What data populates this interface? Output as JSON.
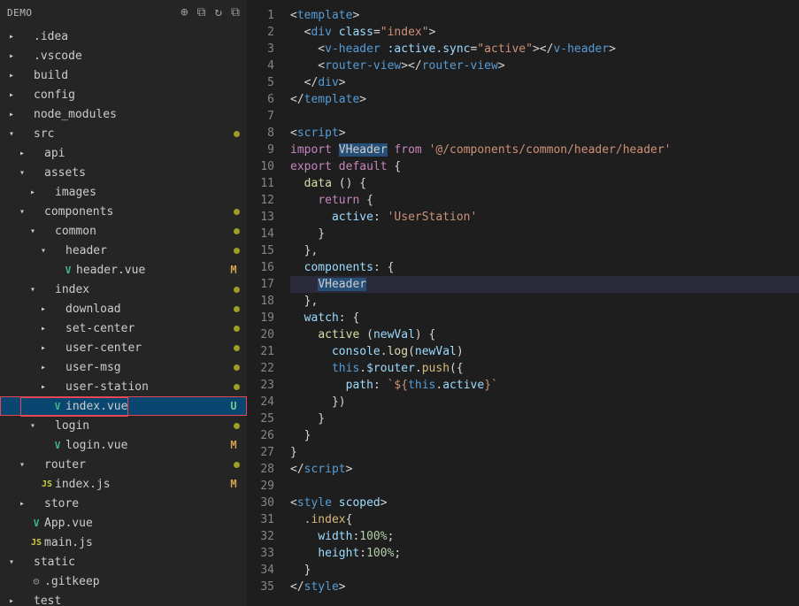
{
  "sidebar": {
    "title": "DEMO",
    "actions": [
      "new-file",
      "new-folder",
      "refresh",
      "collapse"
    ],
    "tree": [
      {
        "indent": 0,
        "chev": "▸",
        "icon": "",
        "label": ".idea"
      },
      {
        "indent": 0,
        "chev": "▸",
        "icon": "",
        "label": ".vscode"
      },
      {
        "indent": 0,
        "chev": "▸",
        "icon": "",
        "label": "build"
      },
      {
        "indent": 0,
        "chev": "▸",
        "icon": "",
        "label": "config"
      },
      {
        "indent": 0,
        "chev": "▸",
        "icon": "",
        "label": "node_modules"
      },
      {
        "indent": 0,
        "chev": "▾",
        "icon": "",
        "label": "src",
        "dot": "olive"
      },
      {
        "indent": 1,
        "chev": "▸",
        "icon": "",
        "label": "api"
      },
      {
        "indent": 1,
        "chev": "▾",
        "icon": "",
        "label": "assets"
      },
      {
        "indent": 2,
        "chev": "▸",
        "icon": "",
        "label": "images"
      },
      {
        "indent": 1,
        "chev": "▾",
        "icon": "",
        "label": "components",
        "dot": "olive"
      },
      {
        "indent": 2,
        "chev": "▾",
        "icon": "",
        "label": "common",
        "dot": "olive"
      },
      {
        "indent": 3,
        "chev": "▾",
        "icon": "",
        "label": "header",
        "dot": "olive"
      },
      {
        "indent": 4,
        "chev": "",
        "icon": "vue",
        "label": "header.vue",
        "letter": "M"
      },
      {
        "indent": 2,
        "chev": "▾",
        "icon": "",
        "label": "index",
        "dot": "olive"
      },
      {
        "indent": 3,
        "chev": "▸",
        "icon": "",
        "label": "download",
        "dot": "olive"
      },
      {
        "indent": 3,
        "chev": "▸",
        "icon": "",
        "label": "set-center",
        "dot": "olive"
      },
      {
        "indent": 3,
        "chev": "▸",
        "icon": "",
        "label": "user-center",
        "dot": "olive"
      },
      {
        "indent": 3,
        "chev": "▸",
        "icon": "",
        "label": "user-msg",
        "dot": "olive"
      },
      {
        "indent": 3,
        "chev": "▸",
        "icon": "",
        "label": "user-station",
        "dot": "olive"
      },
      {
        "indent": 3,
        "chev": "",
        "icon": "vue",
        "label": "index.vue",
        "letter": "U",
        "selected": true
      },
      {
        "indent": 2,
        "chev": "▾",
        "icon": "",
        "label": "login",
        "dot": "olive"
      },
      {
        "indent": 3,
        "chev": "",
        "icon": "vue",
        "label": "login.vue",
        "letter": "M"
      },
      {
        "indent": 1,
        "chev": "▾",
        "icon": "",
        "label": "router",
        "dot": "olive"
      },
      {
        "indent": 2,
        "chev": "",
        "icon": "js",
        "label": "index.js",
        "letter": "M"
      },
      {
        "indent": 1,
        "chev": "▸",
        "icon": "",
        "label": "store"
      },
      {
        "indent": 1,
        "chev": "",
        "icon": "vue",
        "label": "App.vue"
      },
      {
        "indent": 1,
        "chev": "",
        "icon": "js",
        "label": "main.js"
      },
      {
        "indent": 0,
        "chev": "▾",
        "icon": "",
        "label": "static"
      },
      {
        "indent": 1,
        "chev": "",
        "icon": "gear",
        "label": ".gitkeep"
      },
      {
        "indent": 0,
        "chev": "▸",
        "icon": "",
        "label": "test"
      }
    ]
  },
  "editor": {
    "lines": [
      {
        "n": 1,
        "parts": [
          [
            "plain",
            "<"
          ],
          [
            "tag",
            "template"
          ],
          [
            "plain",
            ">"
          ]
        ]
      },
      {
        "n": 2,
        "parts": [
          [
            "plain",
            "  <"
          ],
          [
            "tag",
            "div"
          ],
          [
            "plain",
            " "
          ],
          [
            "attr",
            "class"
          ],
          [
            "plain",
            "="
          ],
          [
            "str",
            "\"index\""
          ],
          [
            "plain",
            ">"
          ]
        ]
      },
      {
        "n": 3,
        "parts": [
          [
            "plain",
            "    <"
          ],
          [
            "tag",
            "v-header"
          ],
          [
            "plain",
            " "
          ],
          [
            "attr",
            ":active.sync"
          ],
          [
            "plain",
            "="
          ],
          [
            "str",
            "\"active\""
          ],
          [
            "plain",
            "></"
          ],
          [
            "tag",
            "v-header"
          ],
          [
            "plain",
            ">"
          ]
        ]
      },
      {
        "n": 4,
        "parts": [
          [
            "plain",
            "    <"
          ],
          [
            "tag",
            "router-view"
          ],
          [
            "plain",
            "></"
          ],
          [
            "tag",
            "router-view"
          ],
          [
            "plain",
            ">"
          ]
        ]
      },
      {
        "n": 5,
        "parts": [
          [
            "plain",
            "  </"
          ],
          [
            "tag",
            "div"
          ],
          [
            "plain",
            ">"
          ]
        ]
      },
      {
        "n": 6,
        "parts": [
          [
            "plain",
            "</"
          ],
          [
            "tag",
            "template"
          ],
          [
            "plain",
            ">"
          ]
        ]
      },
      {
        "n": 7,
        "parts": []
      },
      {
        "n": 8,
        "parts": [
          [
            "plain",
            "<"
          ],
          [
            "tag",
            "script"
          ],
          [
            "plain",
            ">"
          ]
        ]
      },
      {
        "n": 9,
        "parts": [
          [
            "kw",
            "import"
          ],
          [
            "plain",
            " "
          ],
          [
            "sel",
            "VHeader"
          ],
          [
            "plain",
            " "
          ],
          [
            "kw",
            "from"
          ],
          [
            "plain",
            " "
          ],
          [
            "str",
            "'@/components/common/header/header'"
          ]
        ]
      },
      {
        "n": 10,
        "parts": [
          [
            "kw",
            "export"
          ],
          [
            "plain",
            " "
          ],
          [
            "kw",
            "default"
          ],
          [
            "plain",
            " {"
          ]
        ]
      },
      {
        "n": 11,
        "parts": [
          [
            "plain",
            "  "
          ],
          [
            "fn",
            "data"
          ],
          [
            "plain",
            " () {"
          ]
        ]
      },
      {
        "n": 12,
        "parts": [
          [
            "plain",
            "    "
          ],
          [
            "kw",
            "return"
          ],
          [
            "plain",
            " {"
          ]
        ]
      },
      {
        "n": 13,
        "parts": [
          [
            "plain",
            "      "
          ],
          [
            "prop",
            "active"
          ],
          [
            "plain",
            ": "
          ],
          [
            "str",
            "'UserStation'"
          ]
        ]
      },
      {
        "n": 14,
        "parts": [
          [
            "plain",
            "    }"
          ]
        ]
      },
      {
        "n": 15,
        "parts": [
          [
            "plain",
            "  },"
          ]
        ]
      },
      {
        "n": 16,
        "parts": [
          [
            "plain",
            "  "
          ],
          [
            "prop",
            "components"
          ],
          [
            "plain",
            ": {"
          ]
        ]
      },
      {
        "n": 17,
        "current": true,
        "parts": [
          [
            "plain",
            "    "
          ],
          [
            "sel",
            "VHeader"
          ]
        ]
      },
      {
        "n": 18,
        "parts": [
          [
            "plain",
            "  },"
          ]
        ]
      },
      {
        "n": 19,
        "parts": [
          [
            "plain",
            "  "
          ],
          [
            "prop",
            "watch"
          ],
          [
            "plain",
            ": {"
          ]
        ]
      },
      {
        "n": 20,
        "parts": [
          [
            "plain",
            "    "
          ],
          [
            "fn",
            "active"
          ],
          [
            "plain",
            " ("
          ],
          [
            "prop",
            "newVal"
          ],
          [
            "plain",
            ") {"
          ]
        ]
      },
      {
        "n": 21,
        "parts": [
          [
            "plain",
            "      "
          ],
          [
            "prop",
            "console"
          ],
          [
            "plain",
            "."
          ],
          [
            "fn",
            "log"
          ],
          [
            "plain",
            "("
          ],
          [
            "prop",
            "newVal"
          ],
          [
            "plain",
            ")"
          ]
        ]
      },
      {
        "n": 22,
        "parts": [
          [
            "plain",
            "      "
          ],
          [
            "kw2",
            "this"
          ],
          [
            "plain",
            "."
          ],
          [
            "prop",
            "$router"
          ],
          [
            "plain",
            "."
          ],
          [
            "push",
            "push"
          ],
          [
            "plain",
            "({"
          ]
        ]
      },
      {
        "n": 23,
        "parts": [
          [
            "plain",
            "        "
          ],
          [
            "prop",
            "path"
          ],
          [
            "plain",
            ": "
          ],
          [
            "str",
            "`${"
          ],
          [
            "kw2",
            "this"
          ],
          [
            "plain",
            "."
          ],
          [
            "prop",
            "active"
          ],
          [
            "str",
            "}`"
          ]
        ]
      },
      {
        "n": 24,
        "parts": [
          [
            "plain",
            "      })"
          ]
        ]
      },
      {
        "n": 25,
        "parts": [
          [
            "plain",
            "    }"
          ]
        ]
      },
      {
        "n": 26,
        "parts": [
          [
            "plain",
            "  }"
          ]
        ]
      },
      {
        "n": 27,
        "parts": [
          [
            "plain",
            "}"
          ]
        ]
      },
      {
        "n": 28,
        "parts": [
          [
            "plain",
            "</"
          ],
          [
            "tag",
            "script"
          ],
          [
            "plain",
            ">"
          ]
        ]
      },
      {
        "n": 29,
        "parts": []
      },
      {
        "n": 30,
        "parts": [
          [
            "plain",
            "<"
          ],
          [
            "tag",
            "style"
          ],
          [
            "plain",
            " "
          ],
          [
            "attr",
            "scoped"
          ],
          [
            "plain",
            ">"
          ]
        ]
      },
      {
        "n": 31,
        "parts": [
          [
            "plain",
            "  "
          ],
          [
            "push",
            ".index"
          ],
          [
            "plain",
            "{"
          ]
        ]
      },
      {
        "n": 32,
        "parts": [
          [
            "plain",
            "    "
          ],
          [
            "prop",
            "width"
          ],
          [
            "plain",
            ":"
          ],
          [
            "num",
            "100%"
          ],
          [
            "plain",
            ";"
          ]
        ]
      },
      {
        "n": 33,
        "parts": [
          [
            "plain",
            "    "
          ],
          [
            "prop",
            "height"
          ],
          [
            "plain",
            ":"
          ],
          [
            "num",
            "100%"
          ],
          [
            "plain",
            ";"
          ]
        ]
      },
      {
        "n": 34,
        "parts": [
          [
            "plain",
            "  }"
          ]
        ]
      },
      {
        "n": 35,
        "parts": [
          [
            "plain",
            "</"
          ],
          [
            "tag",
            "style"
          ],
          [
            "plain",
            ">"
          ]
        ]
      }
    ]
  }
}
